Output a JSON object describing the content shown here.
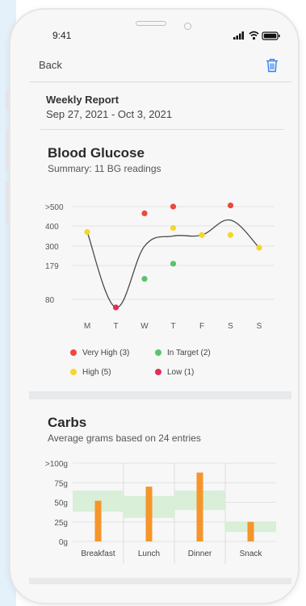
{
  "status_bar": {
    "time": "9:41"
  },
  "nav": {
    "back_label": "Back",
    "delete_icon": "trash-icon",
    "accent_color": "#2f80ed"
  },
  "report": {
    "title": "Weekly Report",
    "date_range": "Sep 27, 2021 - Oct 3, 2021"
  },
  "blood_glucose": {
    "title": "Blood Glucose",
    "summary": "Summary: 11 BG readings",
    "legend": [
      {
        "label": "Very High (3)",
        "color": "#f0473d"
      },
      {
        "label": "In Target (2)",
        "color": "#5ac36c"
      },
      {
        "label": "High (5)",
        "color": "#f6d62b"
      },
      {
        "label": "Low (1)",
        "color": "#e52d52"
      }
    ]
  },
  "carbs": {
    "title": "Carbs",
    "subtitle": "Average grams based on 24 entries"
  },
  "chart_data": [
    {
      "type": "scatter",
      "title": "Blood Glucose",
      "categories": [
        "M",
        "T",
        "W",
        "T",
        "F",
        "S",
        "S"
      ],
      "y_tick_labels": [
        ">500",
        "400",
        "300",
        "179",
        "80"
      ],
      "y_tick_values": [
        500,
        400,
        300,
        179,
        80
      ],
      "ylim": [
        0,
        500
      ],
      "grid": true,
      "trend_line": [
        {
          "x": 0,
          "y": 370
        },
        {
          "x": 1,
          "y": 0
        },
        {
          "x": 2,
          "y": 300
        },
        {
          "x": 3,
          "y": 350
        },
        {
          "x": 4,
          "y": 355
        },
        {
          "x": 5,
          "y": 430
        },
        {
          "x": 6,
          "y": 290
        }
      ],
      "points": [
        {
          "x": 0,
          "y": 370,
          "level": "High",
          "color": "#f6d62b"
        },
        {
          "x": 1,
          "y": 0,
          "level": "Low",
          "color": "#e52d52"
        },
        {
          "x": 2,
          "y": 140,
          "level": "In Target",
          "color": "#5ac36c"
        },
        {
          "x": 2,
          "y": 465,
          "level": "Very High",
          "color": "#f0473d"
        },
        {
          "x": 3,
          "y": 500,
          "level": "Very High",
          "color": "#f0473d"
        },
        {
          "x": 3,
          "y": 390,
          "level": "High",
          "color": "#f6d62b"
        },
        {
          "x": 3,
          "y": 190,
          "level": "In Target",
          "color": "#5ac36c"
        },
        {
          "x": 4,
          "y": 355,
          "level": "High",
          "color": "#f6d62b"
        },
        {
          "x": 5,
          "y": 510,
          "level": "Very High",
          "color": "#f0473d"
        },
        {
          "x": 5,
          "y": 355,
          "level": "High",
          "color": "#f6d62b"
        },
        {
          "x": 6,
          "y": 290,
          "level": "High",
          "color": "#f6d62b"
        }
      ]
    },
    {
      "type": "bar",
      "title": "Carbs",
      "categories": [
        "Breakfast",
        "Lunch",
        "Dinner",
        "Snack"
      ],
      "values": [
        52,
        70,
        88,
        25
      ],
      "target_bands": [
        [
          38,
          65
        ],
        [
          30,
          58
        ],
        [
          40,
          65
        ],
        [
          12,
          25
        ]
      ],
      "y_tick_labels": [
        ">100g",
        "75g",
        "50g",
        "25g",
        "0g"
      ],
      "y_tick_values": [
        100,
        75,
        50,
        25,
        0
      ],
      "ylim": [
        0,
        100
      ],
      "bar_color": "#f5952a",
      "band_color": "#d9efd8",
      "grid": true
    }
  ]
}
